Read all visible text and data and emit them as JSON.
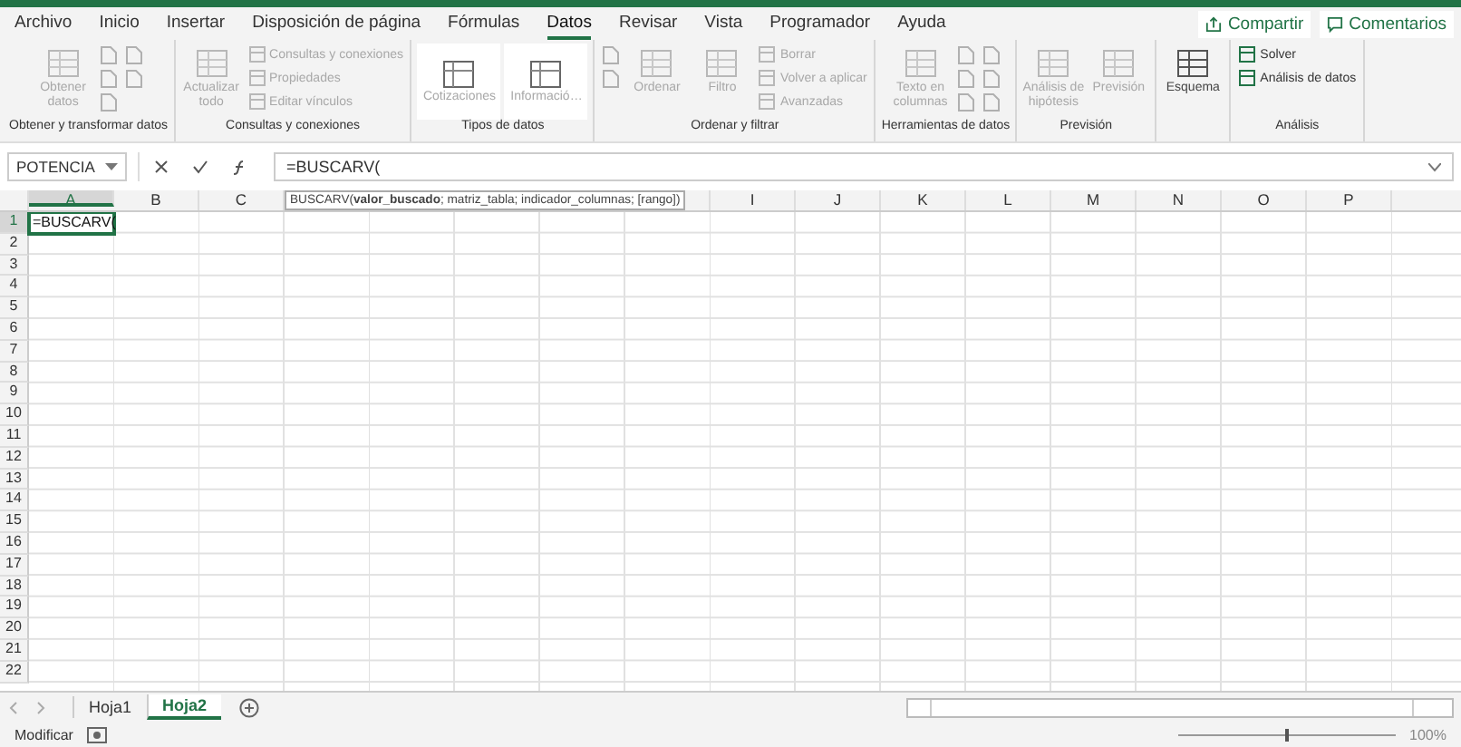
{
  "menu_tabs": [
    {
      "label": "Archivo",
      "selected": false
    },
    {
      "label": "Inicio",
      "selected": false
    },
    {
      "label": "Insertar",
      "selected": false
    },
    {
      "label": "Disposición de página",
      "selected": false
    },
    {
      "label": "Fórmulas",
      "selected": false
    },
    {
      "label": "Datos",
      "selected": true
    },
    {
      "label": "Revisar",
      "selected": false
    },
    {
      "label": "Vista",
      "selected": false
    },
    {
      "label": "Programador",
      "selected": false
    },
    {
      "label": "Ayuda",
      "selected": false
    }
  ],
  "share_button": "Compartir",
  "comments_button": "Comentarios",
  "ribbon_groups": [
    {
      "label": "Obtener y transformar datos",
      "columns": [
        [
          {
            "kind": "large",
            "label": "Obtener datos",
            "disabled": true
          }
        ],
        [
          {
            "kind": "icon",
            "disabled": true
          },
          {
            "kind": "icon",
            "disabled": true
          },
          {
            "kind": "icon",
            "disabled": true
          }
        ],
        [
          {
            "kind": "icon",
            "disabled": true
          },
          {
            "kind": "icon",
            "disabled": true
          }
        ]
      ]
    },
    {
      "label": "Consultas y conexiones",
      "columns": [
        [
          {
            "kind": "large",
            "label": "Actualizar todo",
            "disabled": true
          }
        ],
        [
          {
            "kind": "small",
            "label": "Consultas y conexiones",
            "disabled": true
          },
          {
            "kind": "small",
            "label": "Propiedades",
            "disabled": true
          },
          {
            "kind": "small",
            "label": "Editar vínculos",
            "disabled": true
          }
        ]
      ]
    },
    {
      "label": "Tipos de datos",
      "columns": [
        [
          {
            "kind": "gallery",
            "label": "Cotizaciones",
            "disabled": true
          }
        ],
        [
          {
            "kind": "gallery",
            "label": "Informació…",
            "disabled": true
          }
        ]
      ]
    },
    {
      "label": "Ordenar y filtrar",
      "columns": [
        [
          {
            "kind": "icon",
            "disabled": true
          },
          {
            "kind": "icon",
            "disabled": true
          }
        ],
        [
          {
            "kind": "large",
            "label": "Ordenar",
            "disabled": true
          }
        ],
        [
          {
            "kind": "large",
            "label": "Filtro",
            "disabled": true
          }
        ],
        [
          {
            "kind": "small",
            "label": "Borrar",
            "disabled": true
          },
          {
            "kind": "small",
            "label": "Volver a aplicar",
            "disabled": true
          },
          {
            "kind": "small",
            "label": "Avanzadas",
            "disabled": true
          }
        ]
      ]
    },
    {
      "label": "Herramientas de datos",
      "columns": [
        [
          {
            "kind": "large",
            "label": "Texto en columnas",
            "disabled": true
          }
        ],
        [
          {
            "kind": "icon",
            "disabled": true
          },
          {
            "kind": "icon",
            "disabled": true
          },
          {
            "kind": "icon",
            "disabled": true
          }
        ],
        [
          {
            "kind": "icon",
            "disabled": true
          },
          {
            "kind": "icon",
            "disabled": true
          },
          {
            "kind": "icon",
            "disabled": true
          }
        ]
      ]
    },
    {
      "label": "Previsión",
      "columns": [
        [
          {
            "kind": "large",
            "label": "Análisis de hipótesis",
            "disabled": true
          }
        ],
        [
          {
            "kind": "large",
            "label": "Previsión",
            "disabled": true
          }
        ]
      ]
    },
    {
      "columns": [
        [
          {
            "kind": "large",
            "label": "Esquema",
            "disabled": false
          }
        ]
      ]
    },
    {
      "label": "Análisis",
      "columns": [
        [
          {
            "kind": "small",
            "label": "Solver",
            "disabled": false
          },
          {
            "kind": "small",
            "label": "Análisis de datos",
            "disabled": false
          }
        ]
      ]
    }
  ],
  "name_box": "POTENCIA",
  "formula": "=BUSCARV(",
  "columns_before_tip": [
    "A",
    "B",
    "C"
  ],
  "tooltip": "BUSCARV(**valor_buscado**; matriz_tabla; indicador_columnas; [rango])",
  "columns_after_tip": [
    "I",
    "J",
    "K",
    "L",
    "M",
    "N",
    "O",
    "P"
  ],
  "rows": [
    "1",
    "2",
    "3",
    "4",
    "5",
    "6",
    "7",
    "8",
    "9",
    "10",
    "11",
    "12",
    "13",
    "14",
    "15",
    "16",
    "17",
    "18",
    "19",
    "20",
    "21",
    "22"
  ],
  "active_cell": "=BUSCARV(",
  "sheet_tabs": [
    {
      "label": "Hoja1",
      "selected": false
    },
    {
      "label": "Hoja2",
      "selected": true
    }
  ],
  "status": "Modificar",
  "zoom": "100%",
  "zoom_slider": {
    "level": 0.5
  }
}
